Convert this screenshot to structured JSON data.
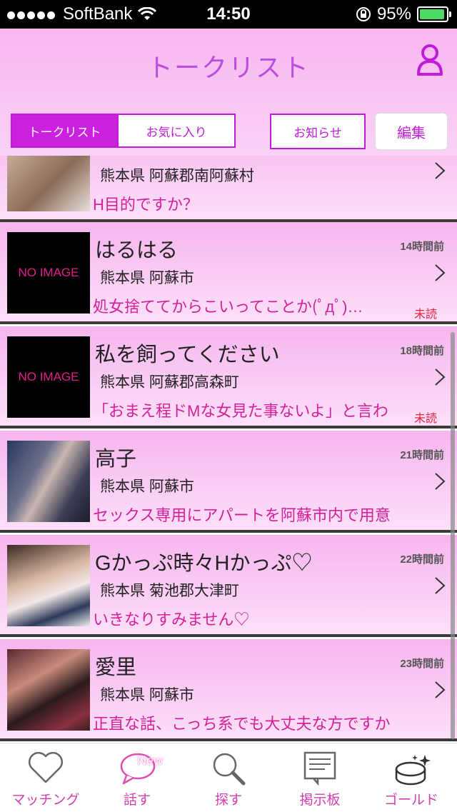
{
  "status": {
    "carrier": "SoftBank",
    "time": "14:50",
    "battery": "95%"
  },
  "header": {
    "title": "トークリスト"
  },
  "tabs": {
    "talk_list": "トークリスト",
    "favorites": "お気に入り",
    "notice": "お知らせ",
    "edit": "編集"
  },
  "noimage_label": "NO IMAGE",
  "rows": [
    {
      "name": "",
      "time": "",
      "location": "熊本県 阿蘇郡南阿蘇村",
      "message": "H目的ですか？",
      "unread": "",
      "thumb": "photo"
    },
    {
      "name": "はるはる",
      "time": "14時間前",
      "location": "熊本県 阿蘇市",
      "message": "処女捨ててからこいってことか(ﾟдﾟ)…",
      "unread": "未読",
      "thumb": "noimage"
    },
    {
      "name": "私を飼ってください",
      "time": "18時間前",
      "location": "熊本県 阿蘇郡高森町",
      "message": "「おまえ程ドMな女見た事ないよ」と言わ",
      "unread": "未読",
      "thumb": "noimage"
    },
    {
      "name": "高子",
      "time": "21時間前",
      "location": "熊本県 阿蘇市",
      "message": "セックス専用にアパートを阿蘇市内で用意",
      "unread": "",
      "thumb": "photo"
    },
    {
      "name": "Gかっぷ時々Hかっぷ♡",
      "time": "22時間前",
      "location": "熊本県 菊池郡大津町",
      "message": "いきなりすみません♡",
      "unread": "",
      "thumb": "photo"
    },
    {
      "name": "愛里",
      "time": "23時間前",
      "location": "熊本県 阿蘇市",
      "message": "正直な話、こっち系でも大丈夫な方ですか",
      "unread": "",
      "thumb": "photo"
    }
  ],
  "tabbar": {
    "matching": "マッチング",
    "talk": "話す",
    "new_badge": "New",
    "search": "探す",
    "board": "掲示板",
    "gold": "ゴールド"
  }
}
